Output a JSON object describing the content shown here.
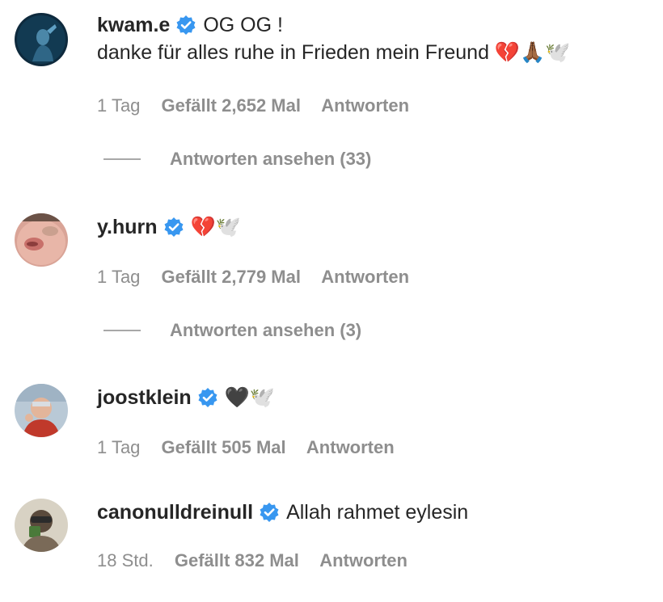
{
  "colors": {
    "text": "#262626",
    "secondary": "#8e8e8e",
    "verified": "#3897f0",
    "background": "#ffffff"
  },
  "comments": [
    {
      "username": "kwam.e",
      "verified": true,
      "text": "OG OG !",
      "text_line2": "danke für alles ruhe in Frieden mein Freund 💔🙏🏾🕊️",
      "time": "1 Tag",
      "likes": "Gefällt 2,652 Mal",
      "reply_label": "Antworten",
      "view_replies": "Antworten ansehen (33)"
    },
    {
      "username": "y.hurn",
      "verified": true,
      "text": "💔🕊️",
      "time": "1 Tag",
      "likes": "Gefällt 2,779 Mal",
      "reply_label": "Antworten",
      "view_replies": "Antworten ansehen (3)"
    },
    {
      "username": "joostklein",
      "verified": true,
      "text": "🖤🕊️",
      "time": "1 Tag",
      "likes": "Gefällt 505 Mal",
      "reply_label": "Antworten"
    },
    {
      "username": "canonulldreinull",
      "verified": true,
      "text": "Allah rahmet eylesin",
      "time": "18 Std.",
      "likes": "Gefällt 832 Mal",
      "reply_label": "Antworten"
    }
  ]
}
